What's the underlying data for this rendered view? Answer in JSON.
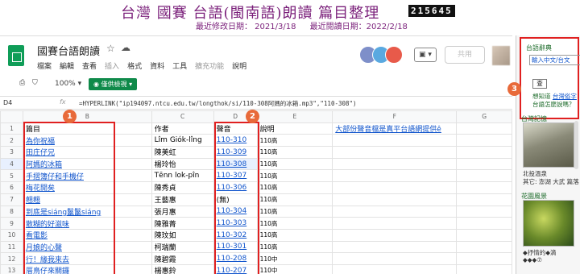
{
  "banner": {
    "title": "台灣 國賽 台語(閩南語)朗讀 篇目整理",
    "counter": "215645",
    "last_modified": "最近修改日期： 2021/3/18",
    "last_viewed": "最近閱讀日期：2022/2/18"
  },
  "app": {
    "doc_title": "國賽台語朗讀",
    "menus": [
      "檔案",
      "編輯",
      "查看",
      "插入",
      "格式",
      "資料",
      "工具",
      "擴充功能",
      "說明"
    ],
    "comment_label": "▣ ▾",
    "share_label": "共用",
    "zoom": "100% ▾",
    "view_only_label": "◉ 僅供檢視 ▾",
    "cell_ref": "D4",
    "fx": "fx",
    "formula": "=HYPERLINK(\"ip194097.ntcu.edu.tw/longthok/si/110-308阿媽的冰箱.mp3\",\"110-308\")"
  },
  "sheet": {
    "columns": [
      "",
      "B",
      "C",
      "D",
      "E",
      "F",
      "G"
    ],
    "header_row": {
      "b": "篇目",
      "c": "作者",
      "d": "聲音",
      "e": "說明",
      "f": "大部份聲音檔是真平台語網提供ê"
    },
    "rows": [
      {
        "n": "2",
        "b": "為你祝福",
        "c": "Lîm Giók-lîng",
        "d": "110-310",
        "e": "110高"
      },
      {
        "n": "3",
        "b": "田庄仔兄",
        "c": "陳美虹",
        "d": "110-309",
        "e": "110高"
      },
      {
        "n": "4",
        "b": "阿媽的冰箱",
        "c": "楊玲怡",
        "d": "110-308",
        "e": "110高"
      },
      {
        "n": "5",
        "b": "手摺簿仔和手機仔",
        "c": "Tēnn lok-pîn",
        "d": "110-307",
        "e": "110高"
      },
      {
        "n": "6",
        "b": "梅花開矣",
        "c": "陳秀貞",
        "d": "110-306",
        "e": "110高"
      },
      {
        "n": "7",
        "b": "翹翹",
        "c": "王藝惠",
        "d": "(無)",
        "e": "110高"
      },
      {
        "n": "8",
        "b": "到底是siáng鬣鬣siáng",
        "c": "張月惠",
        "d": "110-304",
        "e": "110高"
      },
      {
        "n": "9",
        "b": "散糊的好滋味",
        "c": "陳雅菁",
        "d": "110-303",
        "e": "110高"
      },
      {
        "n": "10",
        "b": "看電影",
        "c": "陳玟如",
        "d": "110-302",
        "e": "110高"
      },
      {
        "n": "11",
        "b": "月娘的心聲",
        "c": "柯瑞蘭",
        "d": "110-301",
        "e": "110高"
      },
      {
        "n": "12",
        "b": "行！緣我來去",
        "c": "陳碧霞",
        "d": "110-208",
        "e": "110中"
      },
      {
        "n": "13",
        "b": "厝鳥仔來關鑼",
        "c": "楊惠鈴",
        "d": "110-207",
        "e": "110中"
      }
    ]
  },
  "markers": {
    "m1": "1",
    "m2": "2",
    "m3": "3"
  },
  "sidebar": {
    "heading": "台語辭典",
    "input_value": "輸入中文/台文",
    "search_label": "查",
    "hint_prefix": "想知道",
    "hint_link": "台灣俗字",
    "hint2": "台語怎麼說嗎？",
    "section_calendar": "台灣記憶",
    "caption_1": "北投溫泉",
    "caption_2": "其它: 澎湖 大武 篇落",
    "section_scenery": "花園風景",
    "caption_3": "◆抒情的◆滴",
    "caption_4": "◆◆◆⑦"
  },
  "colors": {
    "accent_red": "#e02020",
    "marker": "#e86a3a",
    "brand_green": "#0f9d58",
    "link": "#1155cc",
    "banner_text": "#7a1f7a"
  }
}
